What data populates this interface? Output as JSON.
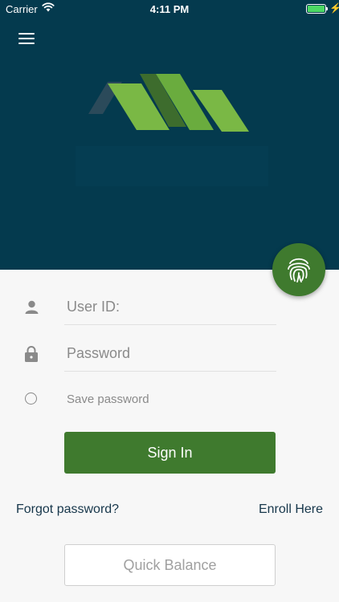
{
  "status_bar": {
    "carrier": "Carrier",
    "time": "4:11 PM"
  },
  "icons": {
    "menu": "hamburger-menu-icon",
    "fingerprint": "fingerprint-icon",
    "user": "user-icon",
    "lock": "lock-icon"
  },
  "colors": {
    "header_bg": "#043a4e",
    "brand_green": "#3f7a2e",
    "logo_light_green": "#7ab845",
    "logo_dark_green": "#4f8c35"
  },
  "form": {
    "user_id_placeholder": "User ID:",
    "password_placeholder": "Password",
    "save_password_label": "Save password",
    "sign_in_label": "Sign In"
  },
  "links": {
    "forgot_password": "Forgot password?",
    "enroll_here": "Enroll Here"
  },
  "quick_balance_label": "Quick Balance"
}
